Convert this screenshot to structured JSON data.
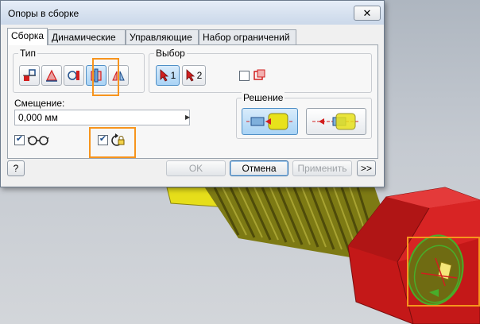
{
  "dialog": {
    "title": "Опоры в сборке",
    "close_glyph": "✕",
    "tabs": [
      {
        "label": "Сборка",
        "active": true
      },
      {
        "label": "Динамические",
        "active": false
      },
      {
        "label": "Управляющие",
        "active": false
      },
      {
        "label": "Набор ограничений",
        "active": false
      }
    ],
    "type_group": {
      "label": "Тип",
      "buttons": [
        {
          "icon": "mate-constraint-icon",
          "pressed": false
        },
        {
          "icon": "angle-constraint-icon",
          "pressed": false
        },
        {
          "icon": "tangent-constraint-icon",
          "pressed": false
        },
        {
          "icon": "insert-constraint-icon",
          "pressed": true
        },
        {
          "icon": "symmetry-constraint-icon",
          "pressed": false
        }
      ]
    },
    "selection_group": {
      "label": "Выбор",
      "sel1_label": "1",
      "sel2_label": "2",
      "pick_part_first_checked": false
    },
    "offset": {
      "label": "Смещение:",
      "value": "0,000 мм"
    },
    "solution_group": {
      "label": "Решение",
      "options": [
        {
          "icon": "opposed-solution-icon",
          "pressed": true
        },
        {
          "icon": "aligned-solution-icon",
          "pressed": false
        }
      ]
    },
    "show_preview_checked": true,
    "predict_offset_checked": true,
    "buttons": {
      "help_glyph": "?",
      "ok": "OK",
      "cancel": "Отмена",
      "apply": "Применить",
      "more": ">>"
    }
  },
  "colors": {
    "highlight": "#f7941d",
    "bolt_head": "#d11f1f",
    "thread": "#7d7a14",
    "washer_yellow": "#e8e21b"
  }
}
